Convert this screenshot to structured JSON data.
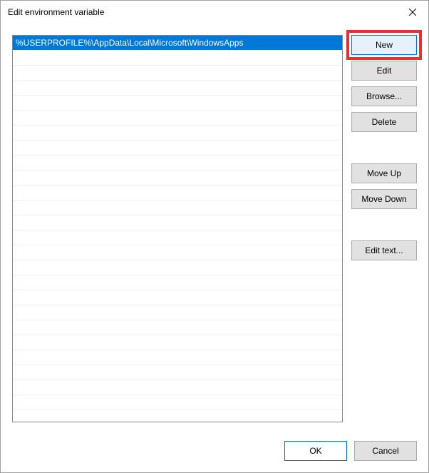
{
  "window": {
    "title": "Edit environment variable"
  },
  "list": {
    "items": [
      "%USERPROFILE%\\AppData\\Local\\Microsoft\\WindowsApps"
    ],
    "selected_index": 0
  },
  "buttons": {
    "new": "New",
    "edit": "Edit",
    "browse": "Browse...",
    "delete": "Delete",
    "move_up": "Move Up",
    "move_down": "Move Down",
    "edit_text": "Edit text...",
    "ok": "OK",
    "cancel": "Cancel"
  }
}
